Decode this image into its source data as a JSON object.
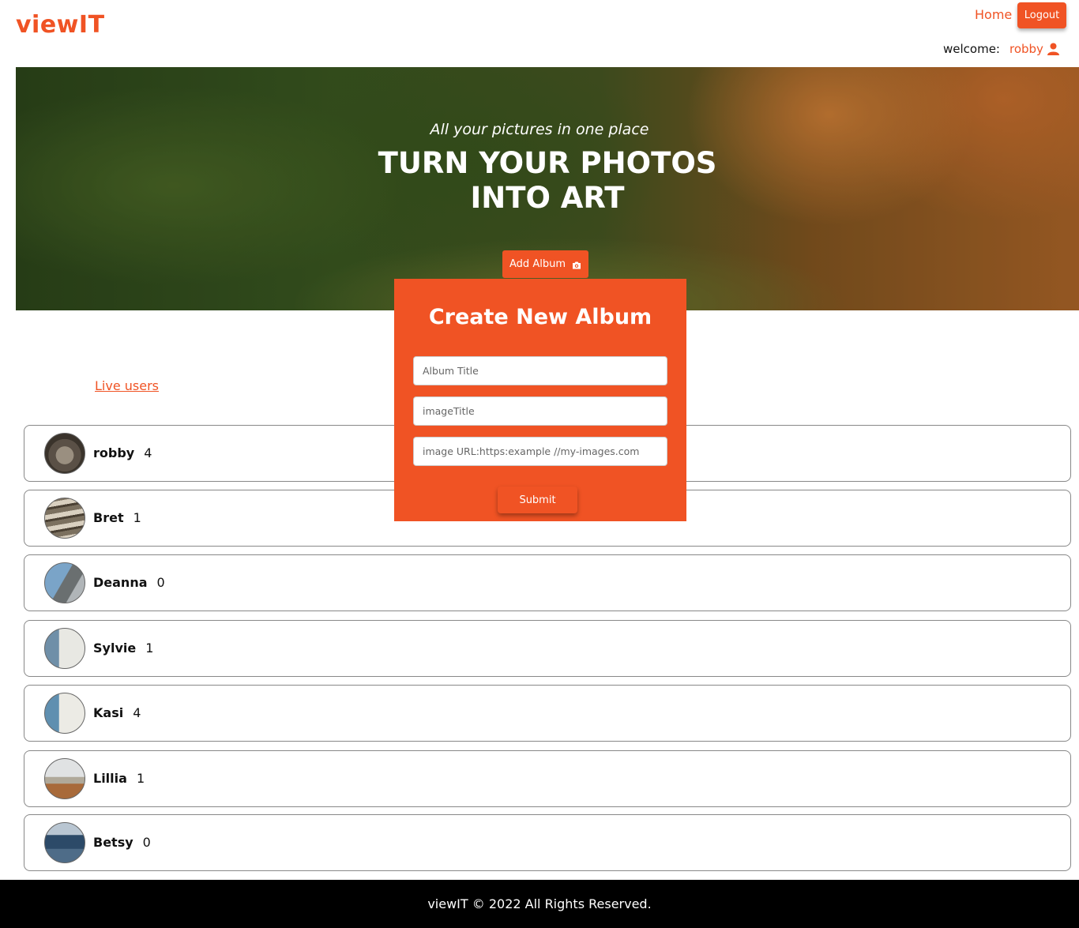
{
  "header": {
    "brand": "viewIT",
    "home_label": "Home",
    "logout_label": "Logout",
    "welcome_label": "welcome:",
    "username": "robby"
  },
  "hero": {
    "subtitle": "All your pictures in one place",
    "title_line1": "TURN YOUR PHOTOS",
    "title_line2": "INTO ART",
    "add_album_label": "Add Album"
  },
  "create_album": {
    "title": "Create New Album",
    "album_title_placeholder": "Album Title",
    "image_title_placeholder": "imageTitle",
    "image_url_placeholder": "image URL:https:example //my-images.com",
    "submit_label": "Submit"
  },
  "live_users_label": "Live users",
  "users": [
    {
      "name": "robby",
      "count": "4"
    },
    {
      "name": "Bret",
      "count": "1"
    },
    {
      "name": "Deanna",
      "count": "0"
    },
    {
      "name": "Sylvie",
      "count": "1"
    },
    {
      "name": "Kasi",
      "count": "4"
    },
    {
      "name": "Lillia",
      "count": "1"
    },
    {
      "name": "Betsy",
      "count": "0"
    }
  ],
  "footer": {
    "text": "viewIT © 2022 All Rights Reserved."
  },
  "colors": {
    "accent": "#f05324",
    "footer_bg": "#000000"
  }
}
